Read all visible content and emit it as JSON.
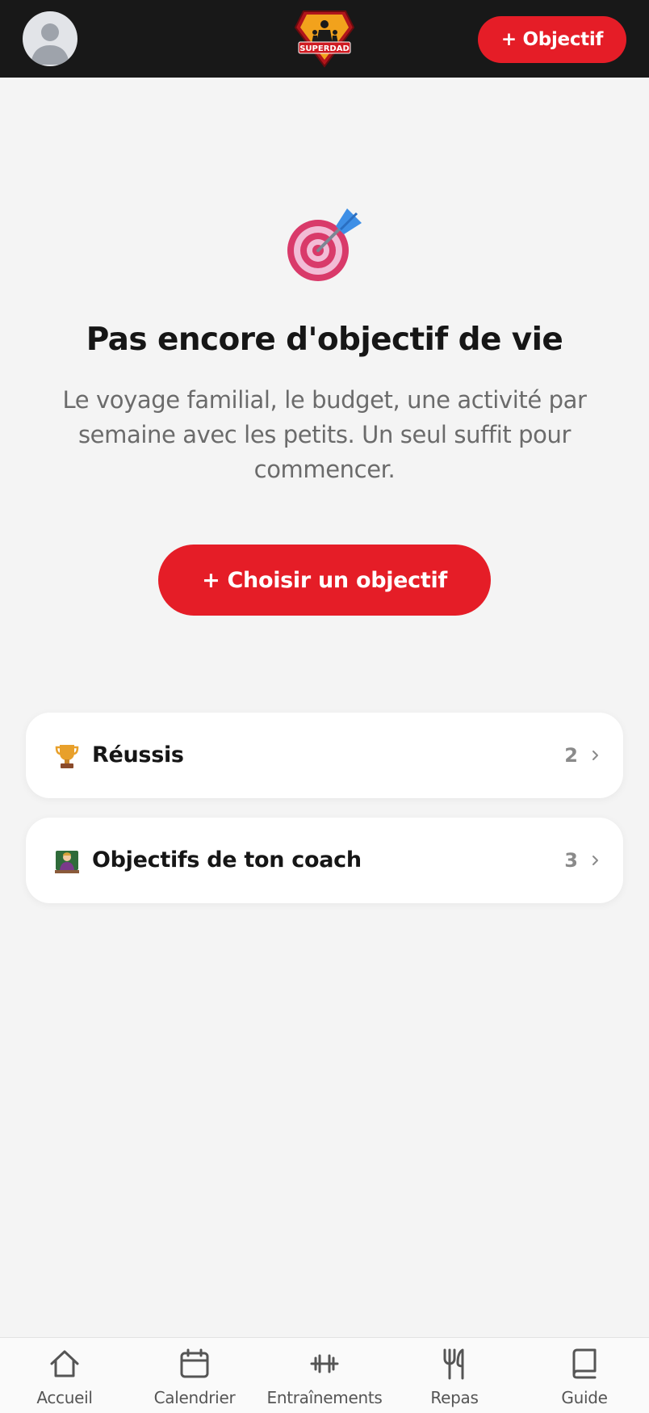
{
  "header": {
    "profile_icon": "user-avatar-icon",
    "logo_text": "SUPERDAD",
    "add_goal_label": "+ Objectif",
    "accent_color": "#e51d27"
  },
  "empty_state": {
    "icon": "target-dart-icon",
    "title": "Pas encore d'objectif de vie",
    "description": "Le voyage familial, le budget, une activité par semaine avec les petits. Un seul suffit pour commencer.",
    "cta_label": "+ Choisir un objectif"
  },
  "sections": [
    {
      "icon": "trophy-icon",
      "label": "Réussis",
      "count": "2"
    },
    {
      "icon": "coach-icon",
      "label": "Objectifs de ton coach",
      "count": "3"
    }
  ],
  "bottom_nav": {
    "items": [
      {
        "icon": "home-icon",
        "label": "Accueil"
      },
      {
        "icon": "calendar-icon",
        "label": "Calendrier"
      },
      {
        "icon": "dumbbell-icon",
        "label": "Entraînements"
      },
      {
        "icon": "fork-knife-icon",
        "label": "Repas"
      },
      {
        "icon": "book-icon",
        "label": "Guide"
      }
    ]
  }
}
